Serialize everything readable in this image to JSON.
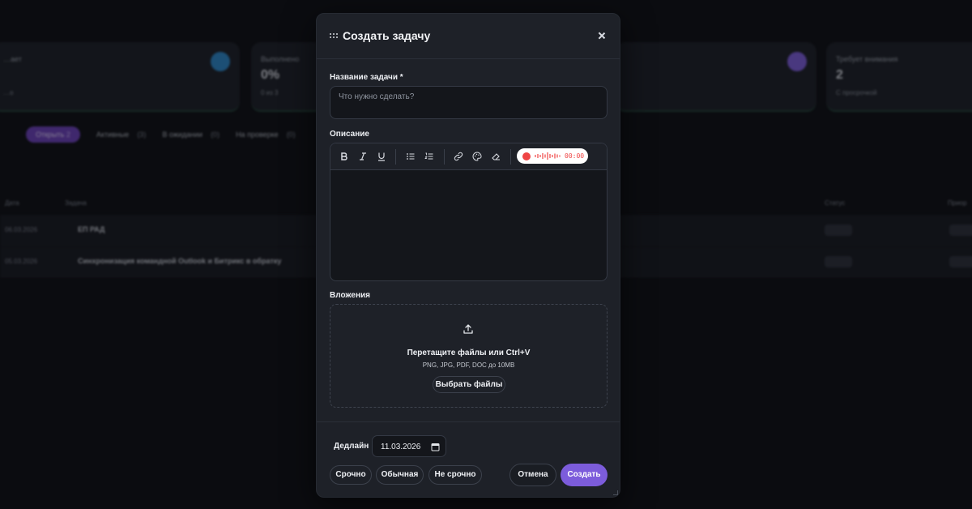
{
  "background": {
    "stat_cards": [
      {
        "label": "…ает",
        "value": "",
        "sub": "…о",
        "icon_color": "#2a86c8"
      },
      {
        "label": "Выполнено",
        "value": "0%",
        "sub": "0 из 3",
        "icon_color": ""
      },
      {
        "label": "",
        "value": "",
        "sub": "",
        "icon_color": "#7c5cdb"
      },
      {
        "label": "Требует внимания",
        "value": "2",
        "sub": "С просрочкой",
        "icon_color": ""
      }
    ],
    "tabs": [
      {
        "label": "Открыть",
        "count": "2",
        "active": true
      },
      {
        "label": "Активные",
        "count": "(3)",
        "active": false
      },
      {
        "label": "В ожидании",
        "count": "(0)",
        "active": false
      },
      {
        "label": "На проверке",
        "count": "(0)",
        "active": false
      }
    ],
    "table_headers": {
      "date": "Дата",
      "task": "Задача",
      "status": "Статус",
      "priority": "Приор"
    },
    "rows": [
      {
        "date": "06.03.2026",
        "title": "ЕП РАД"
      },
      {
        "date": "05.03.2026",
        "title": "Синхронизация командной Outlook и Битрикс в обратку"
      }
    ]
  },
  "modal": {
    "title": "Создать задачу",
    "task_name_label": "Название задачи *",
    "task_name_placeholder": "Что нужно сделать?",
    "description_label": "Описание",
    "recording_time": "00:00",
    "attachments_label": "Вложения",
    "dropzone_text": "Перетащите файлы или Ctrl+V",
    "dropzone_formats": "PNG, JPG, PDF, DOC до 10MB",
    "choose_files": "Выбрать файлы",
    "deadline_label": "Дедлайн",
    "deadline_value": "11.03.2026",
    "priorities": [
      "Срочно",
      "Обычная",
      "Не срочно"
    ],
    "cancel": "Отмена",
    "create": "Создать"
  },
  "colors": {
    "accent": "#7c5cdb",
    "record": "#ef4444",
    "modal_bg": "#1e2128"
  },
  "icons": [
    "drag-grip-icon",
    "close-icon",
    "bold-icon",
    "italic-icon",
    "underline-icon",
    "bullet-list-icon",
    "numbered-list-icon",
    "link-icon",
    "palette-icon",
    "eraser-icon",
    "record-icon",
    "upload-icon",
    "calendar-icon"
  ]
}
